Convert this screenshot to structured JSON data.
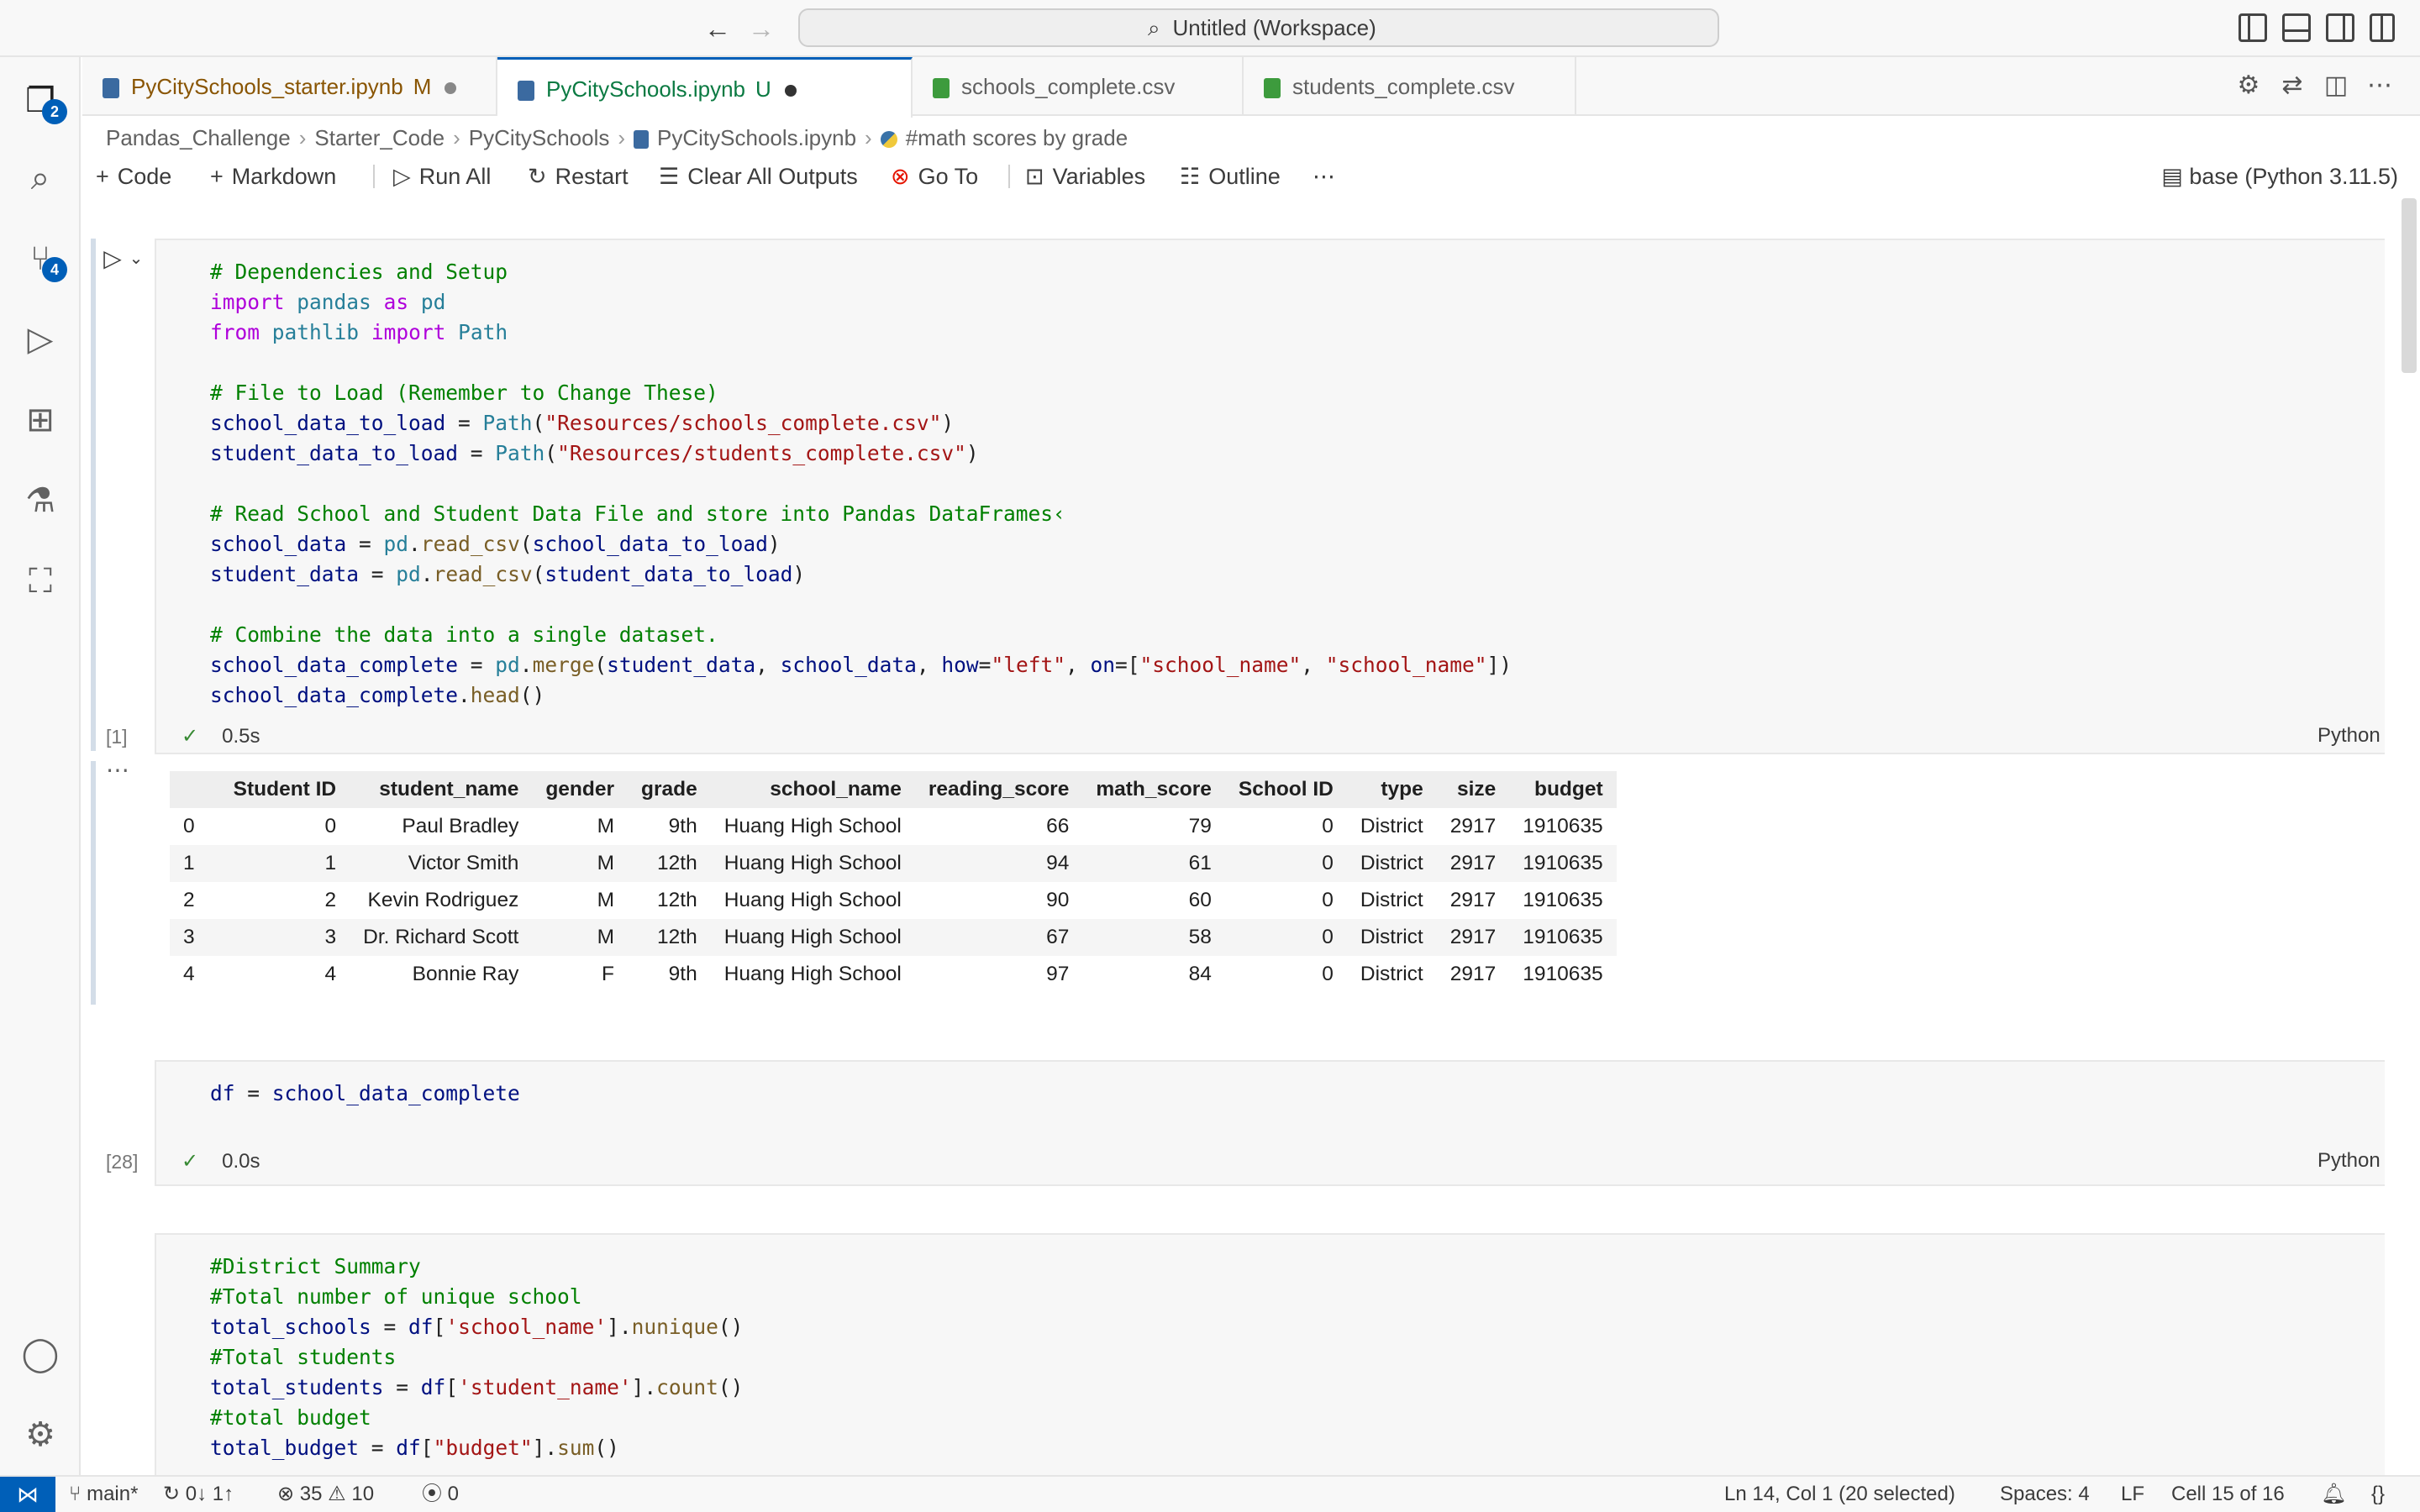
{
  "window": {
    "title": "Untitled (Workspace)"
  },
  "activity": {
    "explorer_badge": "2",
    "scm_badge": "4"
  },
  "tabs": [
    {
      "label": "PyCitySchools_starter.ipynb",
      "mark": "M"
    },
    {
      "label": "PyCitySchools.ipynb",
      "mark": "U"
    },
    {
      "label": "schools_complete.csv"
    },
    {
      "label": "students_complete.csv"
    }
  ],
  "breadcrumb": [
    "Pandas_Challenge",
    "Starter_Code",
    "PyCitySchools",
    "PyCitySchools.ipynb",
    "#math scores by grade"
  ],
  "toolbar": {
    "code": "Code",
    "markdown": "Markdown",
    "run_all": "Run All",
    "restart": "Restart",
    "clear_outputs": "Clear All Outputs",
    "go_to": "Go To",
    "variables": "Variables",
    "outline": "Outline",
    "kernel": "base (Python 3.11.5)"
  },
  "cells": [
    {
      "exec_count": "[1]",
      "duration": "0.5s",
      "language": "Python"
    },
    {
      "exec_count": "[28]",
      "duration": "0.0s",
      "language": "Python"
    }
  ],
  "code": {
    "c1_l1": "# Dependencies and Setup",
    "c1_l2_kw": "import",
    "c1_l2_mod": "pandas",
    "c1_l2_as": "as",
    "c1_l2_alias": "pd",
    "c1_l3_from": "from",
    "c1_l3_mod": "pathlib",
    "c1_l3_imp": "import",
    "c1_l3_cls": "Path",
    "c1_l5": "# File to Load (Remember to Change These)",
    "c1_l6_var": "school_data_to_load",
    "c1_l6_fn": "Path",
    "c1_l6_str": "\"Resources/schools_complete.csv\"",
    "c1_l7_var": "student_data_to_load",
    "c1_l7_fn": "Path",
    "c1_l7_str": "\"Resources/students_complete.csv\"",
    "c1_l9": "# Read School and Student Data File and store into Pandas DataFrames‹",
    "c1_l10_var": "school_data",
    "c1_l10_mod": "pd",
    "c1_l10_fn": "read_csv",
    "c1_l10_arg": "school_data_to_load",
    "c1_l11_var": "student_data",
    "c1_l11_mod": "pd",
    "c1_l11_fn": "read_csv",
    "c1_l11_arg": "student_data_to_load",
    "c1_l13": "# Combine the data into a single dataset.",
    "c1_l14_var": "school_data_complete",
    "c1_l14_mod": "pd",
    "c1_l14_fn": "merge",
    "c1_l14_a1": "student_data",
    "c1_l14_a2": "school_data",
    "c1_l14_k1": "how",
    "c1_l14_s1": "\"left\"",
    "c1_l14_k2": "on",
    "c1_l14_s2": "\"school_name\"",
    "c1_l14_s3": "\"school_name\"",
    "c1_l15_var": "school_data_complete",
    "c1_l15_fn": "head",
    "c2_l1_var": "df",
    "c2_l1_val": "school_data_complete",
    "c3_l1": "#District Summary",
    "c3_l2": "#Total number of unique school",
    "c3_l3_var": "total_schools",
    "c3_l3_df": "df",
    "c3_l3_str": "'school_name'",
    "c3_l3_fn": "nunique",
    "c3_l4": "#Total students",
    "c3_l5_var": "total_students",
    "c3_l5_df": "df",
    "c3_l5_str": "'student_name'",
    "c3_l5_fn": "count",
    "c3_l6": "#total budget",
    "c3_l7_var": "total_budget",
    "c3_l7_df": "df",
    "c3_l7_str": "\"budget\"",
    "c3_l7_fn": "sum"
  },
  "output_table": {
    "columns": [
      "",
      "Student ID",
      "student_name",
      "gender",
      "grade",
      "school_name",
      "reading_score",
      "math_score",
      "School ID",
      "type",
      "size",
      "budget"
    ],
    "rows": [
      [
        "0",
        "0",
        "Paul Bradley",
        "M",
        "9th",
        "Huang High School",
        "66",
        "79",
        "0",
        "District",
        "2917",
        "1910635"
      ],
      [
        "1",
        "1",
        "Victor Smith",
        "M",
        "12th",
        "Huang High School",
        "94",
        "61",
        "0",
        "District",
        "2917",
        "1910635"
      ],
      [
        "2",
        "2",
        "Kevin Rodriguez",
        "M",
        "12th",
        "Huang High School",
        "90",
        "60",
        "0",
        "District",
        "2917",
        "1910635"
      ],
      [
        "3",
        "3",
        "Dr. Richard Scott",
        "M",
        "12th",
        "Huang High School",
        "67",
        "58",
        "0",
        "District",
        "2917",
        "1910635"
      ],
      [
        "4",
        "4",
        "Bonnie Ray",
        "F",
        "9th",
        "Huang High School",
        "97",
        "84",
        "0",
        "District",
        "2917",
        "1910635"
      ]
    ]
  },
  "statusbar": {
    "branch": "main*",
    "sync": "0↓ 1↑",
    "errors": "35",
    "warnings": "10",
    "ports": "0",
    "cursor": "Ln 14, Col 1 (20 selected)",
    "spaces": "Spaces: 4",
    "eol": "LF",
    "cell": "Cell 15 of 16"
  }
}
